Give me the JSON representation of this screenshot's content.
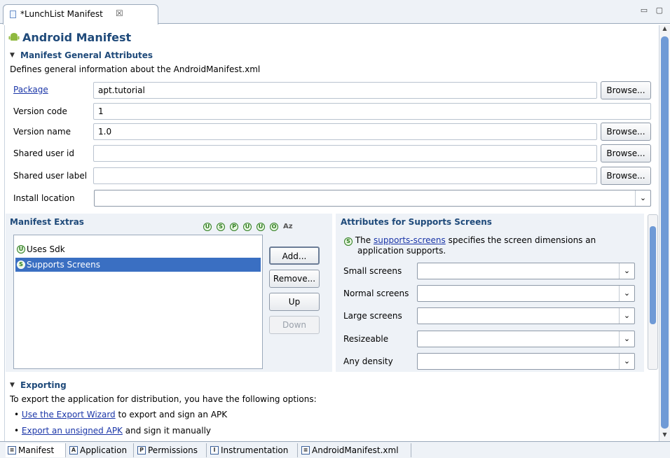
{
  "editor_tab": {
    "title": "*LunchList Manifest",
    "close": "☒"
  },
  "page_title": "Android Manifest",
  "general": {
    "header": "Manifest General Attributes",
    "description": "Defines general information about the AndroidManifest.xml",
    "fields": {
      "package": {
        "label": "Package",
        "value": "apt.tutorial",
        "browse": "Browse..."
      },
      "version_code": {
        "label": "Version code",
        "value": "1"
      },
      "version_name": {
        "label": "Version name",
        "value": "1.0",
        "browse": "Browse..."
      },
      "shared_user_id": {
        "label": "Shared user id",
        "value": "",
        "browse": "Browse..."
      },
      "shared_user_label": {
        "label": "Shared user label",
        "value": "",
        "browse": "Browse..."
      },
      "install_location": {
        "label": "Install location",
        "value": ""
      }
    }
  },
  "extras": {
    "header": "Manifest Extras",
    "toolbar_icons": [
      "U",
      "S",
      "P",
      "U",
      "U",
      "O"
    ],
    "sort_label": "Az",
    "items": [
      {
        "badge": "U",
        "label": "Uses Sdk"
      },
      {
        "badge": "S",
        "label": "Supports Screens"
      }
    ],
    "buttons": {
      "add": "Add...",
      "remove": "Remove...",
      "up": "Up",
      "down": "Down"
    }
  },
  "attributes": {
    "header": "Attributes for Supports Screens",
    "badge": "S",
    "desc_prefix": "The",
    "desc_link": "supports-screens",
    "desc_suffix": "specifies the screen dimensions an",
    "desc_line2": "application supports.",
    "rows": [
      {
        "label": "Small screens",
        "value": ""
      },
      {
        "label": "Normal screens",
        "value": ""
      },
      {
        "label": "Large screens",
        "value": ""
      },
      {
        "label": "Resizeable",
        "value": ""
      },
      {
        "label": "Any density",
        "value": ""
      }
    ]
  },
  "exporting": {
    "header": "Exporting",
    "intro": "To export the application for distribution, you have the following options:",
    "item1_link": "Use the Export Wizard",
    "item1_text": "to export and sign an APK",
    "item2_link": "Export an unsigned APK",
    "item2_text": "and sign it manually"
  },
  "bottom_tabs": [
    {
      "icon": "≡",
      "label": "Manifest"
    },
    {
      "icon": "A",
      "label": "Application"
    },
    {
      "icon": "P",
      "label": "Permissions"
    },
    {
      "icon": "I",
      "label": "Instrumentation"
    },
    {
      "icon": "≡",
      "label": "AndroidManifest.xml"
    }
  ],
  "colors": {
    "accent": "#1f4a7a",
    "selection": "#3a6fc2",
    "link": "#1b36a8",
    "badge_green": "#2f7d20"
  }
}
